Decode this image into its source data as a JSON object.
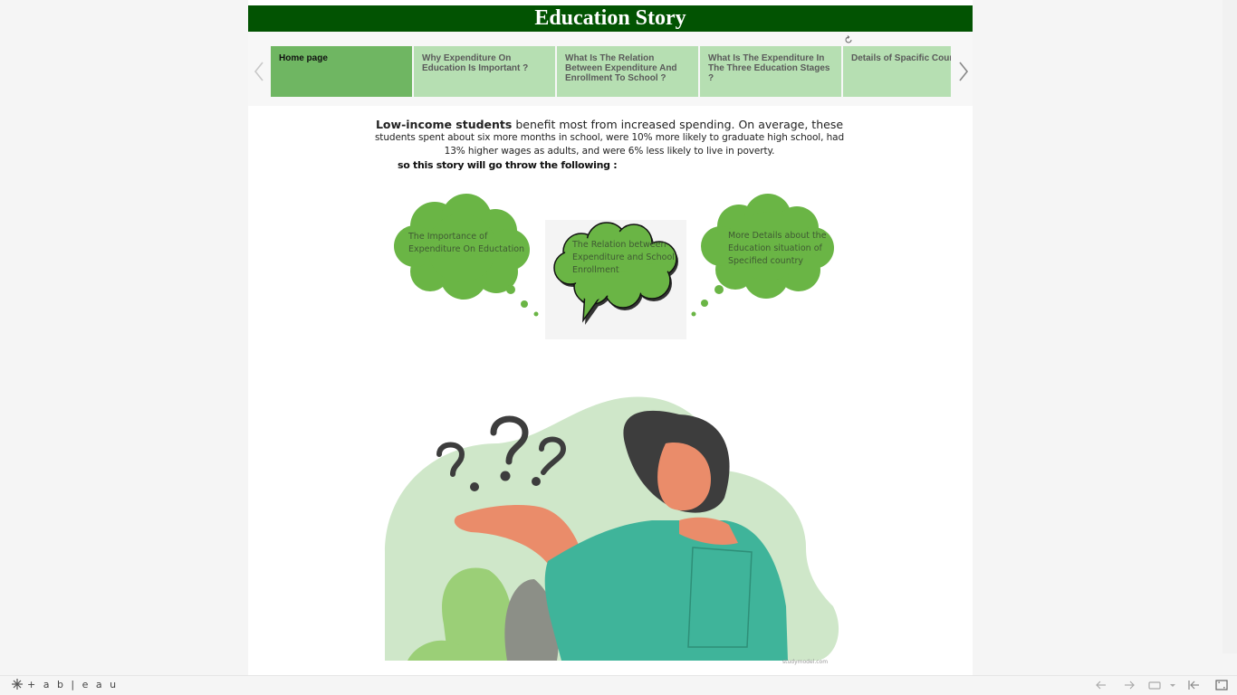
{
  "story": {
    "title": "Education Story"
  },
  "nav": {
    "tabs": [
      {
        "label": "Home page"
      },
      {
        "label": "Why Expenditure On Education Is Important ?"
      },
      {
        "label": "What Is The Relation Between Expenditure And Enrollment To School ?"
      },
      {
        "label": "What Is The Expenditure In The Three Education Stages ?"
      },
      {
        "label": "Details of Spacific Count"
      }
    ],
    "active_index": 0,
    "prev_icon": "chevron-left-icon",
    "next_icon": "chevron-right-icon"
  },
  "intro": {
    "bold_lead": "Low-income students",
    "line1_rest": " benefit most from increased spending. On average, these",
    "line2": "students spent about six more months in school, were 10% more likely to graduate high school, had",
    "line3": "13% higher wages as adults, and were 6%  less likely to live in poverty.",
    "follow": "so this story will go throw the following :"
  },
  "clouds": {
    "left": "The Importance of Expenditure On Eductation",
    "middle": "The Relation between Expenditure and School Enrollment",
    "right": "More Details about the Education situation of Specified country"
  },
  "illustration": {
    "credit": "studymodel.com"
  },
  "footer": {
    "logo_text": "+ a b | e a u",
    "icons": [
      "undo-icon",
      "redo-icon",
      "revert-icon",
      "share-dropdown-icon",
      "reset-icon",
      "fullscreen-icon"
    ]
  },
  "colors": {
    "title_bar": "#025302",
    "active_tab": "#6fb662",
    "inactive_tab": "#b6dfb2",
    "cloud_green": "#6ab545",
    "leaf_light": "#cfe7c9",
    "shirt": "#3fb49a"
  }
}
